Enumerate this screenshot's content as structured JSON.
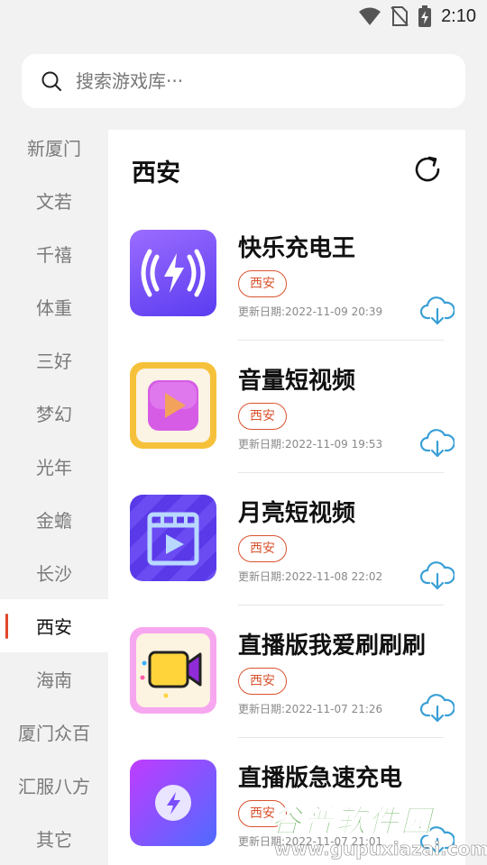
{
  "status_bar": {
    "time": "2:10"
  },
  "search": {
    "placeholder": "搜索游戏库···"
  },
  "sidebar": {
    "items": [
      {
        "label": "新厦门"
      },
      {
        "label": "文若"
      },
      {
        "label": "千禧"
      },
      {
        "label": "体重"
      },
      {
        "label": "三好"
      },
      {
        "label": "梦幻"
      },
      {
        "label": "光年"
      },
      {
        "label": "金蟾"
      },
      {
        "label": "长沙"
      },
      {
        "label": "西安",
        "active": true
      },
      {
        "label": "海南"
      },
      {
        "label": "厦门众百"
      },
      {
        "label": "汇服八方"
      },
      {
        "label": "其它"
      }
    ]
  },
  "panel": {
    "title": "西安",
    "apps": [
      {
        "name": "快乐充电王",
        "tag": "西安",
        "date": "更新日期:2022-11-09 20:39",
        "icon": "charging-wave-icon"
      },
      {
        "name": "音量短视频",
        "tag": "西安",
        "date": "更新日期:2022-11-09 19:53",
        "icon": "video-play-icon"
      },
      {
        "name": "月亮短视频",
        "tag": "西安",
        "date": "更新日期:2022-11-08 22:02",
        "icon": "film-clapper-icon"
      },
      {
        "name": "直播版我爱刷刷刷",
        "tag": "西安",
        "date": "更新日期:2022-11-07 21:26",
        "icon": "video-camera-icon"
      },
      {
        "name": "直播版急速充电",
        "tag": "西安",
        "date": "更新日期:2022-11-07 21:01",
        "icon": "lightning-icon"
      }
    ]
  },
  "watermark": {
    "text": "谷普软件园",
    "url": "www.gupuxiazai.com"
  },
  "colors": {
    "accent": "#e1462b",
    "tag": "#d9532f",
    "download": "#3a9fd6",
    "watermark": "#3a9a2c"
  }
}
